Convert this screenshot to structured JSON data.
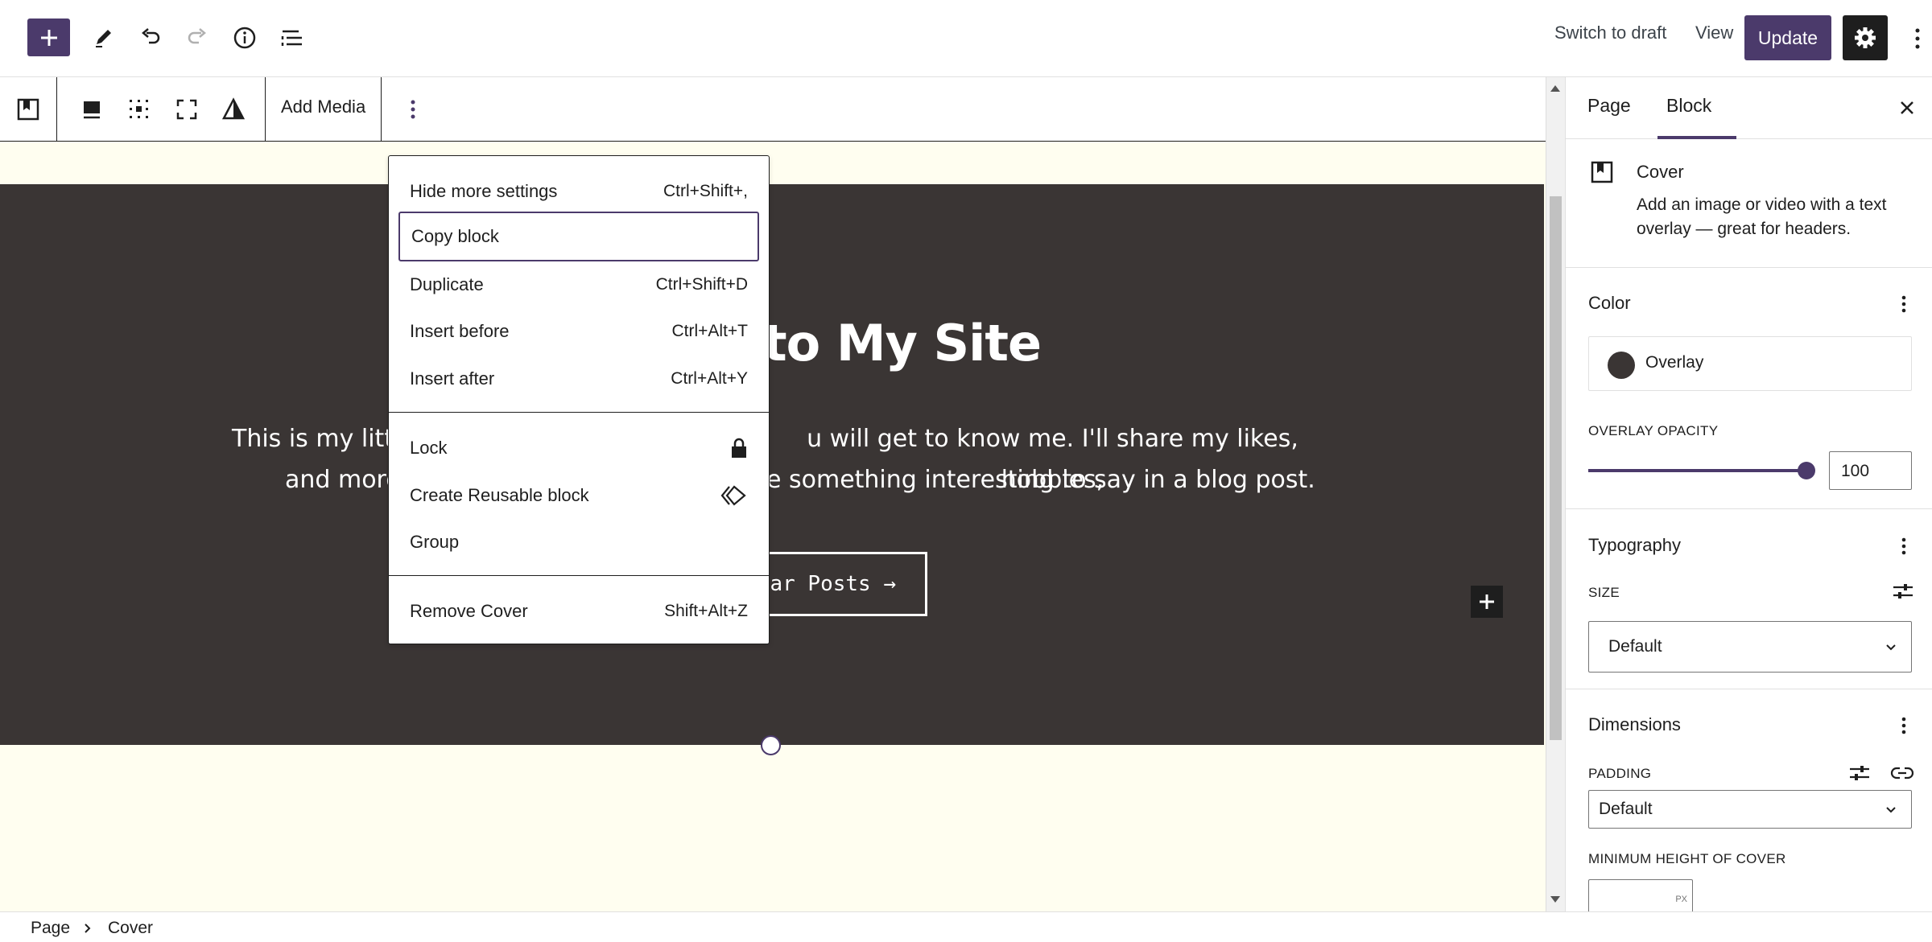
{
  "header": {
    "icons": [
      "plus-icon",
      "pencil-icon",
      "undo-icon",
      "redo-icon",
      "info-icon",
      "list-view-icon"
    ],
    "switch_to_draft": "Switch to draft",
    "view": "View",
    "update": "Update"
  },
  "block_toolbar": {
    "icons": [
      "cover-block-icon",
      "align-icon",
      "content-position-icon",
      "full-height-icon",
      "duotone-icon",
      "more-options-icon"
    ],
    "add_media": "Add Media"
  },
  "cover": {
    "title_visible": "to My Site",
    "text_line1_left": "This is my little",
    "text_line1_right": "u will get to know me.  I'll share my likes, hobbies,",
    "text_line2_left": "and more",
    "text_line2_right": "e something interesting to say in a blog post.",
    "button_visible": "lar Posts →"
  },
  "menu": {
    "items": [
      {
        "label": "Hide more settings",
        "shortcut": "Ctrl+Shift+,"
      },
      {
        "label": "Copy block",
        "shortcut": ""
      },
      {
        "label": "Duplicate",
        "shortcut": "Ctrl+Shift+D"
      },
      {
        "label": "Insert before",
        "shortcut": "Ctrl+Alt+T"
      },
      {
        "label": "Insert after",
        "shortcut": "Ctrl+Alt+Y"
      },
      {
        "label": "Lock",
        "shortcut": ""
      },
      {
        "label": "Create Reusable block",
        "shortcut": ""
      },
      {
        "label": "Group",
        "shortcut": ""
      },
      {
        "label": "Remove Cover",
        "shortcut": "Shift+Alt+Z"
      }
    ]
  },
  "sidebar": {
    "tabs": [
      "Page",
      "Block"
    ],
    "active_tab": "Block",
    "block_name": "Cover",
    "block_description": "Add an image or video with a text overlay — great for headers.",
    "color": {
      "heading": "Color",
      "overlay": "Overlay",
      "overlay_color": "#3a3534"
    },
    "overlay_opacity": {
      "label": "OVERLAY OPACITY",
      "value": "100"
    },
    "typography": {
      "heading": "Typography",
      "size_label": "SIZE",
      "size_value": "Default"
    },
    "dimensions": {
      "heading": "Dimensions",
      "padding_label": "PADDING",
      "padding_value": "Default",
      "min_height_label": "MINIMUM HEIGHT OF COVER",
      "unit": "PX"
    }
  },
  "breadcrumb": [
    "Page",
    "Cover"
  ],
  "colors": {
    "accent": "#4b3a6b",
    "cover_bg": "#3a3534",
    "canvas_bg": "#fffef0"
  }
}
